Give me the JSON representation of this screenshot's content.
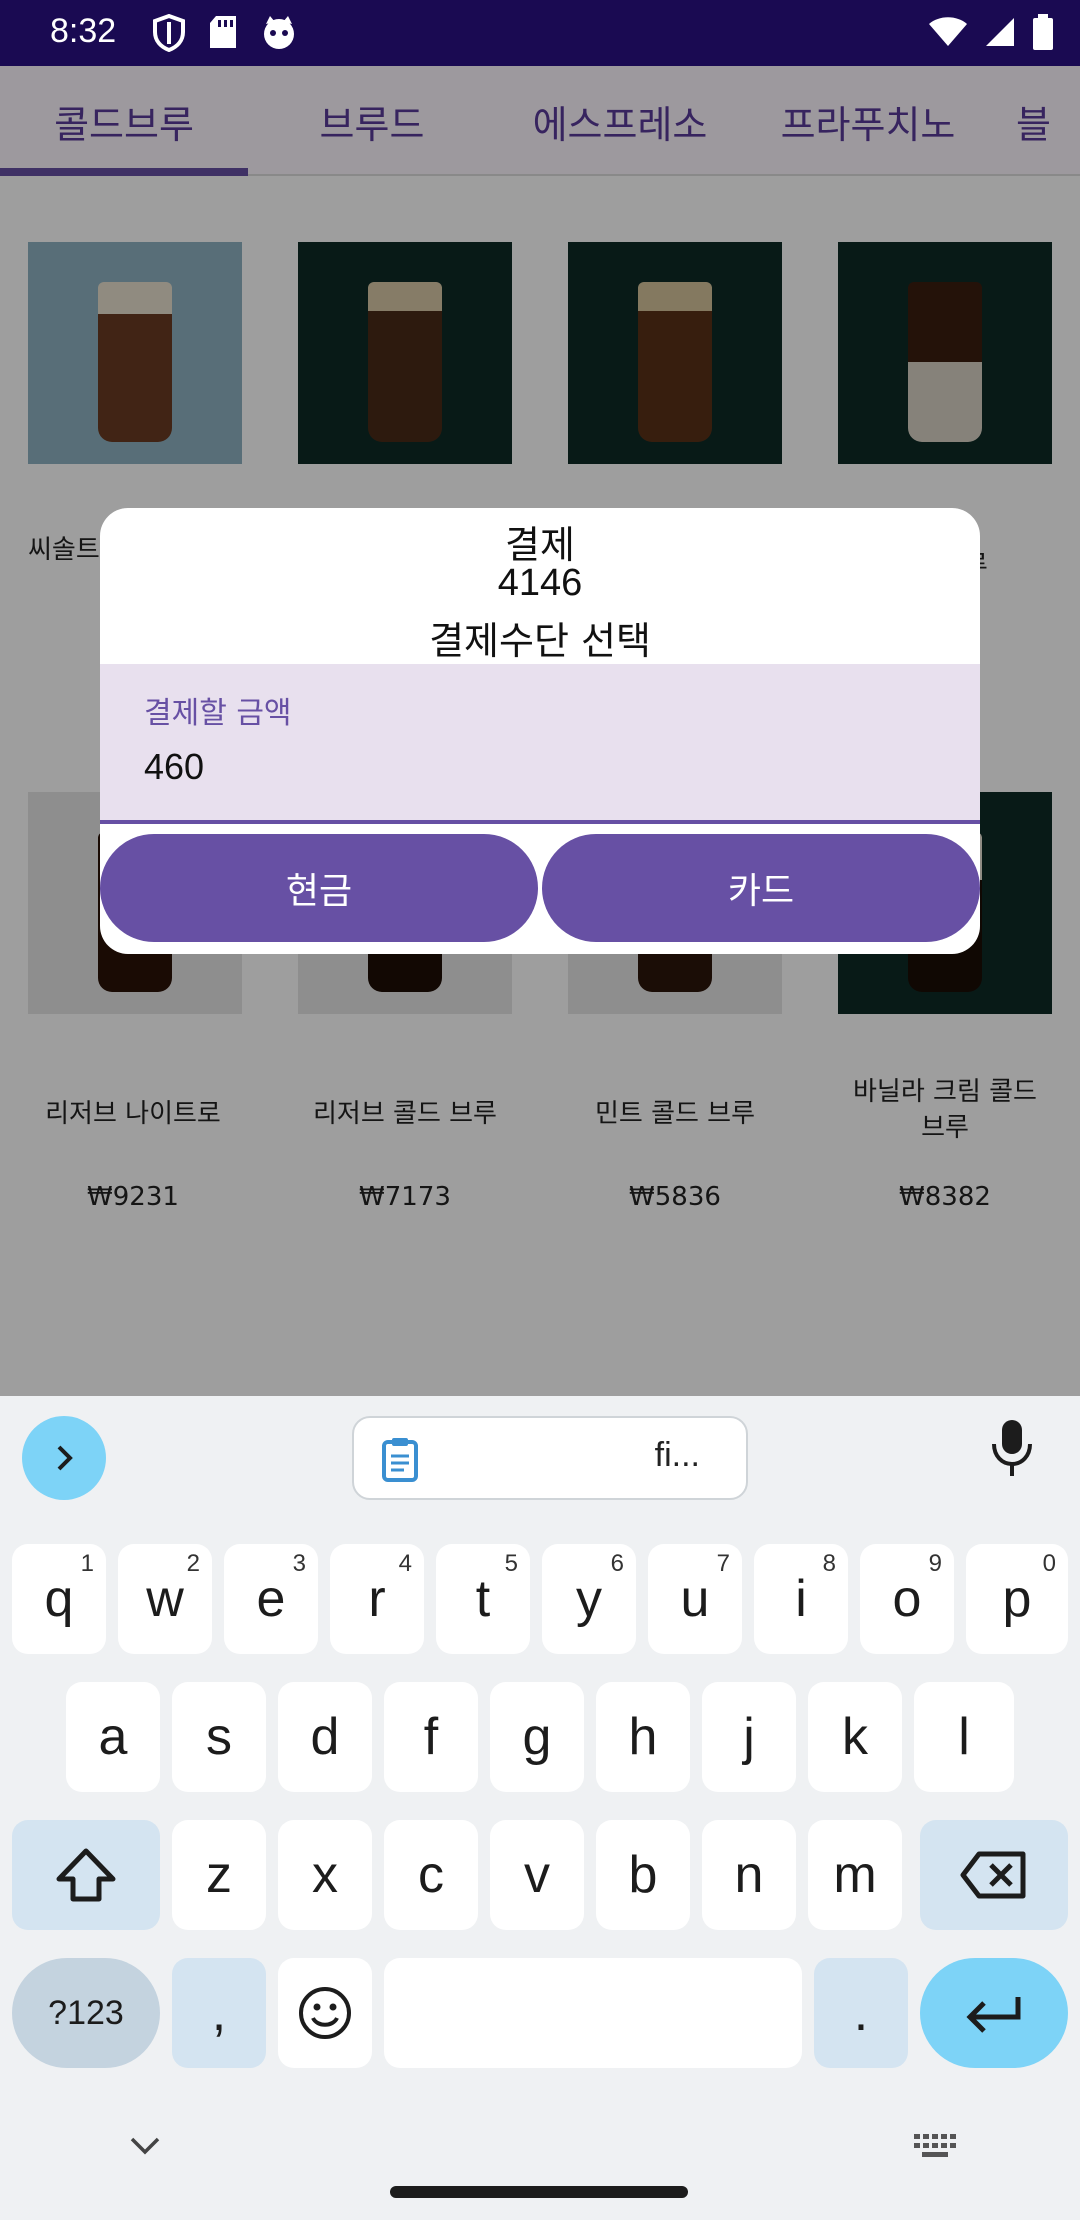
{
  "status_bar": {
    "time": "8:32"
  },
  "tabs": [
    {
      "label": "콜드브루"
    },
    {
      "label": "브루드"
    },
    {
      "label": "에스프레소"
    },
    {
      "label": "프라푸치노"
    },
    {
      "label": "블"
    }
  ],
  "products_row1": [
    {
      "name": "씨솔트",
      "price": ""
    },
    {
      "name": "",
      "price": ""
    },
    {
      "name": "",
      "price": ""
    },
    {
      "name": "브루",
      "price": ""
    }
  ],
  "products_row2": [
    {
      "name": "리저브 나이트로",
      "price": "₩9231"
    },
    {
      "name": "리저브 콜드 브루",
      "price": "₩7173"
    },
    {
      "name": "민트 콜드 브루",
      "price": "₩5836"
    },
    {
      "name": "바닐라 크림 콜드\n브루",
      "price": "₩8382"
    }
  ],
  "dialog": {
    "title": "결제",
    "total": "4146",
    "subtitle": "결제수단 선택",
    "amount_label": "결제할 금액",
    "amount_value": "460",
    "cash_label": "현금",
    "card_label": "카드"
  },
  "keyboard": {
    "clipboard_text": "fi...",
    "row1": [
      {
        "k": "q",
        "h": "1"
      },
      {
        "k": "w",
        "h": "2"
      },
      {
        "k": "e",
        "h": "3"
      },
      {
        "k": "r",
        "h": "4"
      },
      {
        "k": "t",
        "h": "5"
      },
      {
        "k": "y",
        "h": "6"
      },
      {
        "k": "u",
        "h": "7"
      },
      {
        "k": "i",
        "h": "8"
      },
      {
        "k": "o",
        "h": "9"
      },
      {
        "k": "p",
        "h": "0"
      }
    ],
    "row2": [
      "a",
      "s",
      "d",
      "f",
      "g",
      "h",
      "j",
      "k",
      "l"
    ],
    "row3": [
      "z",
      "x",
      "c",
      "v",
      "b",
      "n",
      "m"
    ],
    "sym_label": "?123",
    "comma": ",",
    "period": "."
  }
}
